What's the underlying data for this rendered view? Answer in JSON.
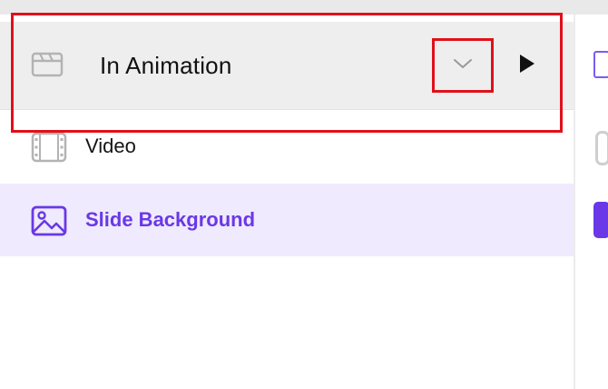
{
  "header": {
    "title": "In Animation",
    "icon": "clapperboard-icon",
    "dropdown_icon": "chevron-down-icon",
    "play_icon": "play-icon"
  },
  "list": {
    "items": [
      {
        "label": "Video",
        "icon": "film-strip-icon",
        "selected": false
      },
      {
        "label": "Slide Background",
        "icon": "image-icon",
        "selected": true
      }
    ]
  },
  "colors": {
    "accent": "#6a38e6",
    "selected_row_bg": "#efeafd",
    "header_bg": "#eeeeee",
    "highlight_outline": "#e0101a"
  }
}
